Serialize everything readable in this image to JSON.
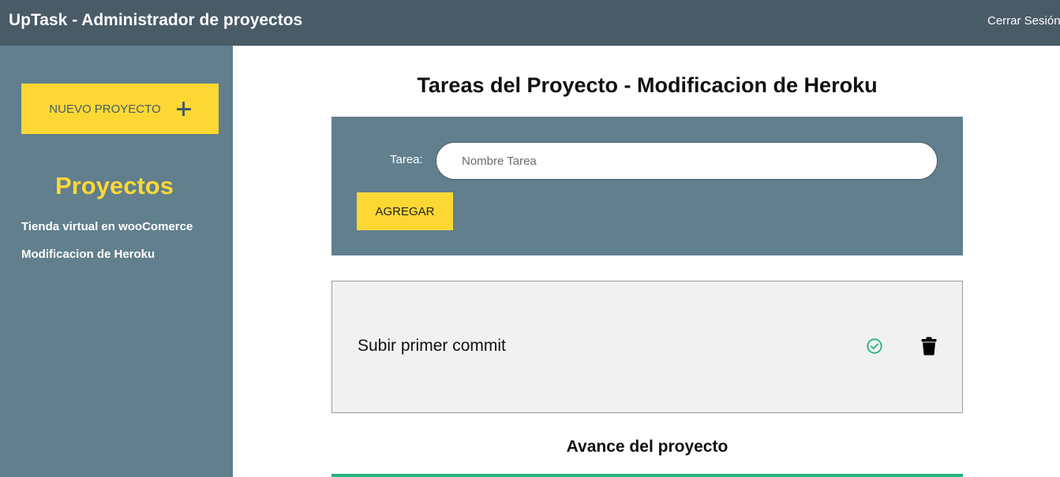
{
  "header": {
    "title": "UpTask - Administrador de proyectos",
    "logout_label": "Cerrar Sesión"
  },
  "sidebar": {
    "new_project_label": "NUEVO PROYECTO",
    "heading": "Proyectos",
    "projects": [
      {
        "name": "Tienda virtual en wooComerce"
      },
      {
        "name": "Modificacion de Heroku"
      }
    ]
  },
  "main": {
    "title": "Tareas del Proyecto - Modificacion de Heroku",
    "form": {
      "label": "Tarea:",
      "placeholder": "Nombre Tarea",
      "value": "",
      "add_label": "AGREGAR"
    },
    "tasks": [
      {
        "name": "Subir primer commit",
        "status_icon": "check-circle-icon",
        "delete_icon": "trash-icon"
      }
    ],
    "progress": {
      "title": "Avance del proyecto",
      "percent": 100
    }
  },
  "colors": {
    "header_bg": "#485b67",
    "sidebar_bg": "#617f8d",
    "accent_yellow": "#fdd835",
    "success_green": "#24b47e"
  }
}
